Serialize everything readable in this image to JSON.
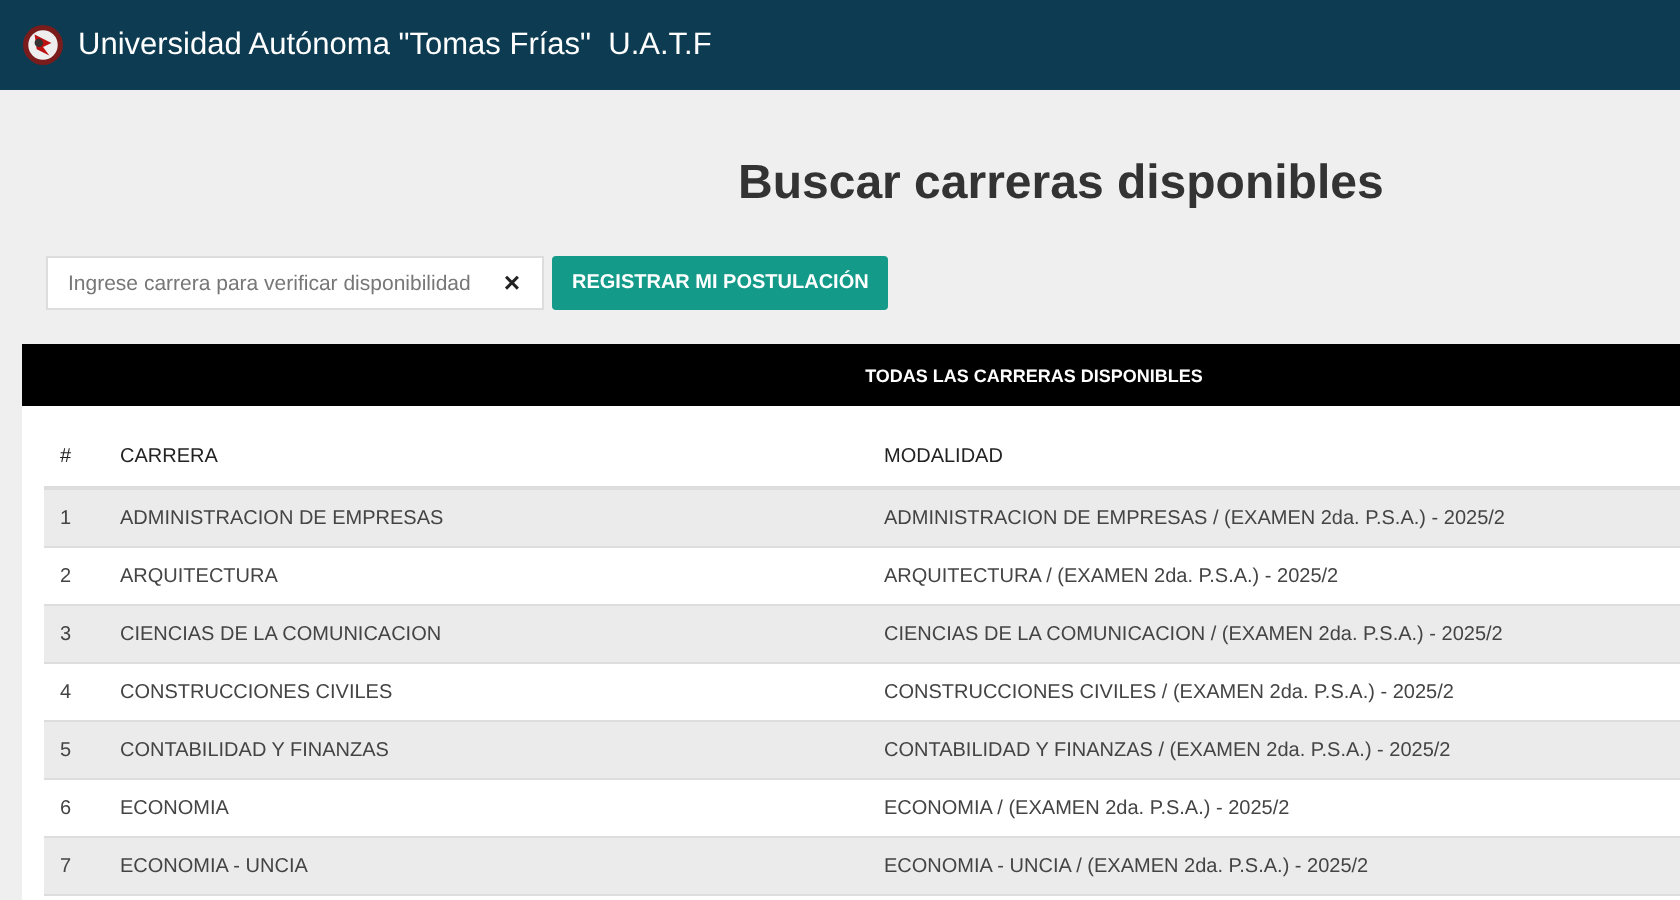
{
  "header": {
    "title": "Universidad Autónoma \"Tomas Frías\"  U.A.T.F"
  },
  "page_title": "Buscar carreras disponibles",
  "search": {
    "placeholder": "Ingrese carrera para verificar disponibilidad",
    "clear": "×"
  },
  "register_button": "REGISTRAR MI POSTULACIÓN",
  "table": {
    "title": "TODAS LAS CARRERAS DISPONIBLES",
    "columns": [
      "#",
      "CARRERA",
      "MODALIDAD"
    ],
    "rows": [
      [
        "1",
        "ADMINISTRACION DE EMPRESAS",
        "ADMINISTRACION DE EMPRESAS / (EXAMEN 2da. P.S.A.) - 2025/2"
      ],
      [
        "2",
        "ARQUITECTURA",
        "ARQUITECTURA / (EXAMEN 2da. P.S.A.) - 2025/2"
      ],
      [
        "3",
        "CIENCIAS DE LA COMUNICACION",
        "CIENCIAS DE LA COMUNICACION / (EXAMEN 2da. P.S.A.) - 2025/2"
      ],
      [
        "4",
        "CONSTRUCCIONES CIVILES",
        "CONSTRUCCIONES CIVILES / (EXAMEN 2da. P.S.A.) - 2025/2"
      ],
      [
        "5",
        "CONTABILIDAD Y FINANZAS",
        "CONTABILIDAD Y FINANZAS / (EXAMEN 2da. P.S.A.) - 2025/2"
      ],
      [
        "6",
        "ECONOMIA",
        "ECONOMIA / (EXAMEN 2da. P.S.A.) - 2025/2"
      ],
      [
        "7",
        "ECONOMIA - UNCIA",
        "ECONOMIA - UNCIA / (EXAMEN 2da. P.S.A.) - 2025/2"
      ]
    ]
  }
}
